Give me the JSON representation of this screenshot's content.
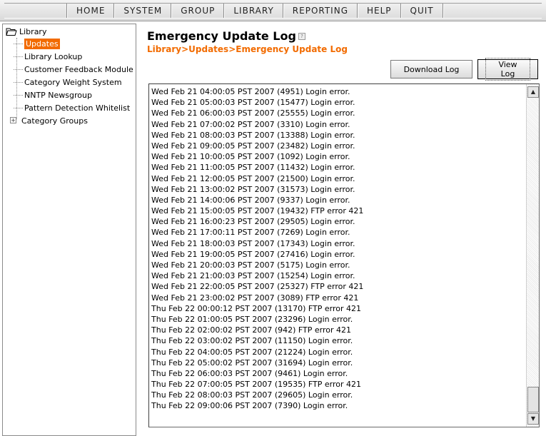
{
  "nav": {
    "items": [
      "HOME",
      "SYSTEM",
      "GROUP",
      "LIBRARY",
      "REPORTING",
      "HELP",
      "QUIT"
    ]
  },
  "sidebar": {
    "root": "Library",
    "items": [
      {
        "label": "Updates",
        "selected": true
      },
      {
        "label": "Library Lookup"
      },
      {
        "label": "Customer Feedback Module"
      },
      {
        "label": "Category Weight System"
      },
      {
        "label": "NNTP Newsgroup"
      },
      {
        "label": "Pattern Detection Whitelist"
      }
    ],
    "groups_label": "Category Groups",
    "expander": "+"
  },
  "main": {
    "title": "Emergency Update Log",
    "breadcrumb": "Library>Updates>Emergency Update Log",
    "download_label": "Download Log",
    "view_label": "View Log"
  },
  "log": {
    "lines": [
      "Wed Feb 21 04:00:05 PST 2007 (4951) Login error.",
      "Wed Feb 21 05:00:03 PST 2007 (15477) Login error.",
      "Wed Feb 21 06:00:03 PST 2007 (25555) Login error.",
      "Wed Feb 21 07:00:02 PST 2007 (3310) Login error.",
      "Wed Feb 21 08:00:03 PST 2007 (13388) Login error.",
      "Wed Feb 21 09:00:05 PST 2007 (23482) Login error.",
      "Wed Feb 21 10:00:05 PST 2007 (1092) Login error.",
      "Wed Feb 21 11:00:05 PST 2007 (11432) Login error.",
      "Wed Feb 21 12:00:05 PST 2007 (21500) Login error.",
      "Wed Feb 21 13:00:02 PST 2007 (31573) Login error.",
      "Wed Feb 21 14:00:06 PST 2007 (9337) Login error.",
      "Wed Feb 21 15:00:05 PST 2007 (19432) FTP error 421",
      "Wed Feb 21 16:00:23 PST 2007 (29505) Login error.",
      "Wed Feb 21 17:00:11 PST 2007 (7269) Login error.",
      "Wed Feb 21 18:00:03 PST 2007 (17343) Login error.",
      "Wed Feb 21 19:00:05 PST 2007 (27416) Login error.",
      "Wed Feb 21 20:00:03 PST 2007 (5175) Login error.",
      "Wed Feb 21 21:00:03 PST 2007 (15254) Login error.",
      "Wed Feb 21 22:00:05 PST 2007 (25327) FTP error 421",
      "Wed Feb 21 23:00:02 PST 2007 (3089) FTP error 421",
      "Thu Feb 22 00:00:12 PST 2007 (13170) FTP error 421",
      "Thu Feb 22 01:00:05 PST 2007 (23296) Login error.",
      "Thu Feb 22 02:00:02 PST 2007 (942) FTP error 421",
      "Thu Feb 22 03:00:02 PST 2007 (11150) Login error.",
      "Thu Feb 22 04:00:05 PST 2007 (21224) Login error.",
      "Thu Feb 22 05:00:02 PST 2007 (31694) Login error.",
      "Thu Feb 22 06:00:03 PST 2007 (9461) Login error.",
      "Thu Feb 22 07:00:05 PST 2007 (19535) FTP error 421",
      "Thu Feb 22 08:00:03 PST 2007 (29605) Login error.",
      "Thu Feb 22 09:00:06 PST 2007 (7390) Login error."
    ],
    "scroll_up_glyph": "▲",
    "scroll_down_glyph": "▼"
  },
  "icons": {
    "root": "folder-icon",
    "help": "help-icon"
  },
  "colors": {
    "accent": "#f26b00"
  }
}
